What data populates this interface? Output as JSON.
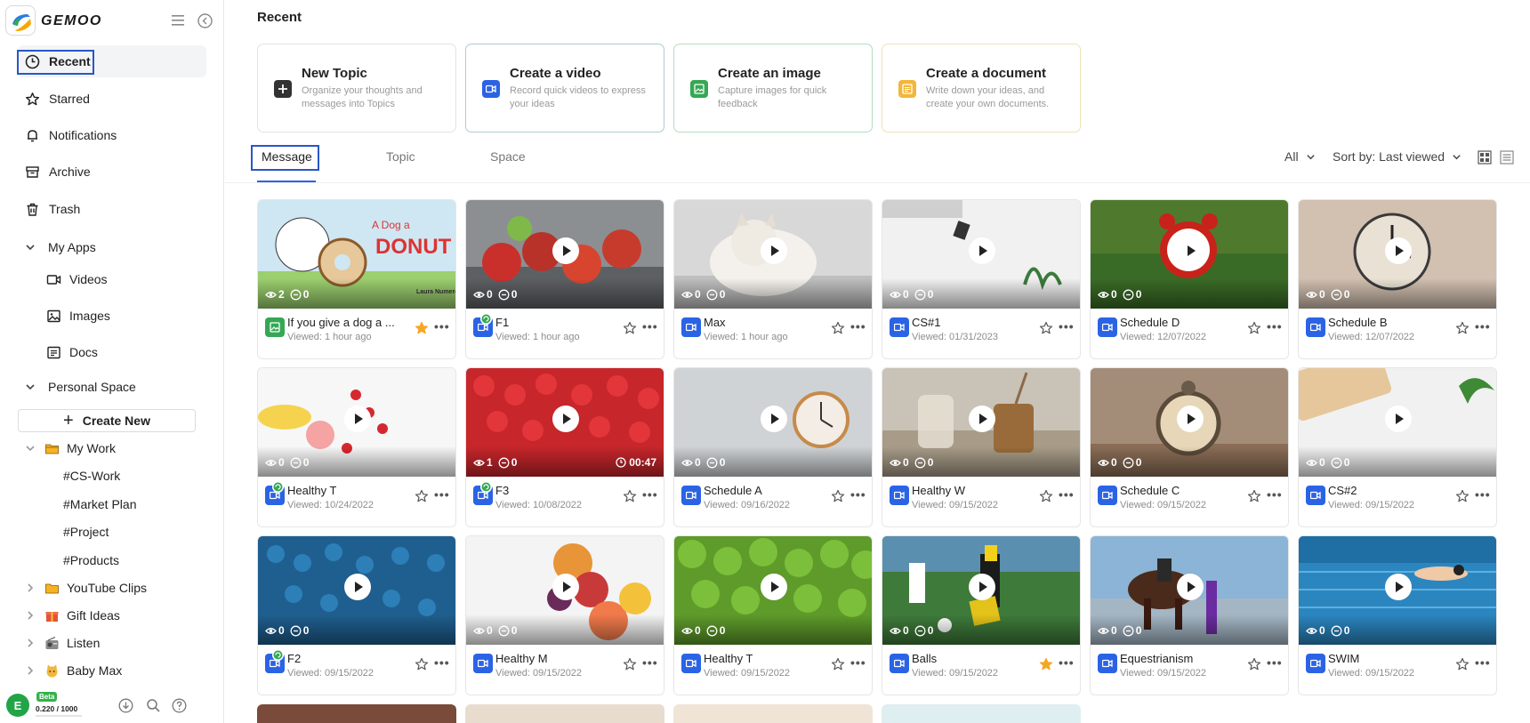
{
  "app": {
    "logo_text": "GEMOO"
  },
  "sidebar": {
    "nav": [
      {
        "label": "Recent",
        "icon": "clock-icon"
      },
      {
        "label": "Starred",
        "icon": "star-icon"
      },
      {
        "label": "Notifications",
        "icon": "bell-icon"
      },
      {
        "label": "Archive",
        "icon": "archive-icon"
      },
      {
        "label": "Trash",
        "icon": "trash-icon"
      }
    ],
    "my_apps": {
      "label": "My Apps",
      "items": [
        "Videos",
        "Images",
        "Docs"
      ]
    },
    "personal_space": {
      "label": "Personal Space",
      "create_new": "Create New"
    },
    "my_work": {
      "label": "My Work",
      "tags": [
        "#CS-Work",
        "#Market Plan",
        "#Project",
        "#Products"
      ]
    },
    "folders": [
      "YouTube Clips",
      "Gift Ideas",
      "Listen",
      "Baby Max"
    ],
    "footer": {
      "avatar_letter": "E",
      "beta": "Beta",
      "usage": "0.220 / 1000"
    }
  },
  "main": {
    "title": "Recent",
    "quick": [
      {
        "title": "New Topic",
        "desc": "Organize your thoughts and messages into Topics"
      },
      {
        "title": "Create a video",
        "desc": "Record quick videos to express your ideas"
      },
      {
        "title": "Create an image",
        "desc": "Capture images for quick feedback"
      },
      {
        "title": "Create a document",
        "desc": "Write down your ideas, and create your own documents."
      }
    ],
    "tabs": [
      "Message",
      "Topic",
      "Space"
    ],
    "filter_all": "All",
    "sort": "Sort by: Last viewed",
    "cards": [
      {
        "title": "If you give a dog a ...",
        "date": "Viewed: 1 hour ago",
        "views": "2",
        "comments": "0",
        "type": "image",
        "starred": true,
        "thumb_text": "DONUT",
        "thumb_author": "Laura Numeroff"
      },
      {
        "title": "F1",
        "date": "Viewed: 1 hour ago",
        "views": "0",
        "comments": "0",
        "type": "video",
        "starred": false,
        "badge": true
      },
      {
        "title": "Max",
        "date": "Viewed: 1 hour ago",
        "views": "0",
        "comments": "0",
        "type": "video",
        "starred": false
      },
      {
        "title": "CS#1",
        "date": "Viewed: 01/31/2023",
        "views": "0",
        "comments": "0",
        "type": "video",
        "starred": false
      },
      {
        "title": "Schedule D",
        "date": "Viewed: 12/07/2022",
        "views": "0",
        "comments": "0",
        "type": "video",
        "starred": false
      },
      {
        "title": "Schedule B",
        "date": "Viewed: 12/07/2022",
        "views": "0",
        "comments": "0",
        "type": "video",
        "starred": false
      },
      {
        "title": "Healthy T",
        "date": "Viewed: 10/24/2022",
        "views": "0",
        "comments": "0",
        "type": "video",
        "starred": false,
        "badge": true
      },
      {
        "title": "F3",
        "date": "Viewed: 10/08/2022",
        "views": "1",
        "comments": "0",
        "type": "video",
        "starred": false,
        "badge": true,
        "duration": "00:47"
      },
      {
        "title": "Schedule A",
        "date": "Viewed: 09/16/2022",
        "views": "0",
        "comments": "0",
        "type": "video",
        "starred": false
      },
      {
        "title": "Healthy W",
        "date": "Viewed: 09/15/2022",
        "views": "0",
        "comments": "0",
        "type": "video",
        "starred": false
      },
      {
        "title": "Schedule C",
        "date": "Viewed: 09/15/2022",
        "views": "0",
        "comments": "0",
        "type": "video",
        "starred": false
      },
      {
        "title": "CS#2",
        "date": "Viewed: 09/15/2022",
        "views": "0",
        "comments": "0",
        "type": "video",
        "starred": false
      },
      {
        "title": "F2",
        "date": "Viewed: 09/15/2022",
        "views": "0",
        "comments": "0",
        "type": "video",
        "starred": false,
        "badge": true
      },
      {
        "title": "Healthy M",
        "date": "Viewed: 09/15/2022",
        "views": "0",
        "comments": "0",
        "type": "video",
        "starred": false
      },
      {
        "title": "Healthy T",
        "date": "Viewed: 09/15/2022",
        "views": "0",
        "comments": "0",
        "type": "video",
        "starred": false
      },
      {
        "title": "Balls",
        "date": "Viewed: 09/15/2022",
        "views": "0",
        "comments": "0",
        "type": "video",
        "starred": true
      },
      {
        "title": "Equestrianism",
        "date": "Viewed: 09/15/2022",
        "views": "0",
        "comments": "0",
        "type": "video",
        "starred": false
      },
      {
        "title": "SWIM",
        "date": "Viewed: 09/15/2022",
        "views": "0",
        "comments": "0",
        "type": "video",
        "starred": false
      }
    ]
  },
  "colors": {
    "accent": "#2b63e5",
    "outline": "#2857c7",
    "star": "#f5a623",
    "green": "#34a853"
  }
}
